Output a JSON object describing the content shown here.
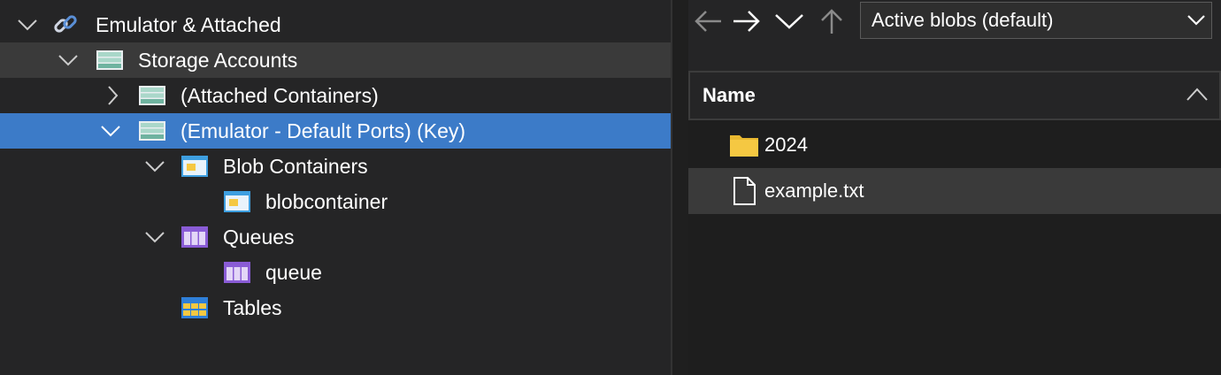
{
  "tree": {
    "root": {
      "label": "Emulator & Attached",
      "icon": "link-icon"
    },
    "storage_accounts": {
      "label": "Storage Accounts",
      "icon": "storage-account-icon"
    },
    "attached_containers": {
      "label": "(Attached Containers)",
      "icon": "storage-account-icon"
    },
    "emulator_default": {
      "label": "(Emulator - Default Ports) (Key)",
      "icon": "storage-account-icon"
    },
    "blob_containers": {
      "label": "Blob Containers",
      "icon": "blob-container-icon"
    },
    "blobcontainer": {
      "label": "blobcontainer",
      "icon": "blob-container-icon"
    },
    "queues": {
      "label": "Queues",
      "icon": "queue-icon"
    },
    "queue": {
      "label": "queue",
      "icon": "queue-icon"
    },
    "tables": {
      "label": "Tables",
      "icon": "table-icon"
    }
  },
  "toolbar": {
    "back_icon": "arrow-left-icon",
    "forward_icon": "arrow-right-icon",
    "expand_icon": "chevron-down-icon",
    "up_icon": "arrow-up-icon",
    "view_select": {
      "value": "Active blobs (default)"
    }
  },
  "list": {
    "header": {
      "name_label": "Name",
      "sort": "ascending"
    },
    "rows": [
      {
        "name": "2024",
        "icon": "folder-icon"
      },
      {
        "name": "example.txt",
        "icon": "file-icon"
      }
    ]
  },
  "colors": {
    "selected_row": "#3c7bc8",
    "hover_row": "#3a3a3a",
    "panel_bg": "#252526",
    "folder": "#f5c842",
    "queue": "#8a5cd6",
    "storage": "#a9d7c9"
  }
}
